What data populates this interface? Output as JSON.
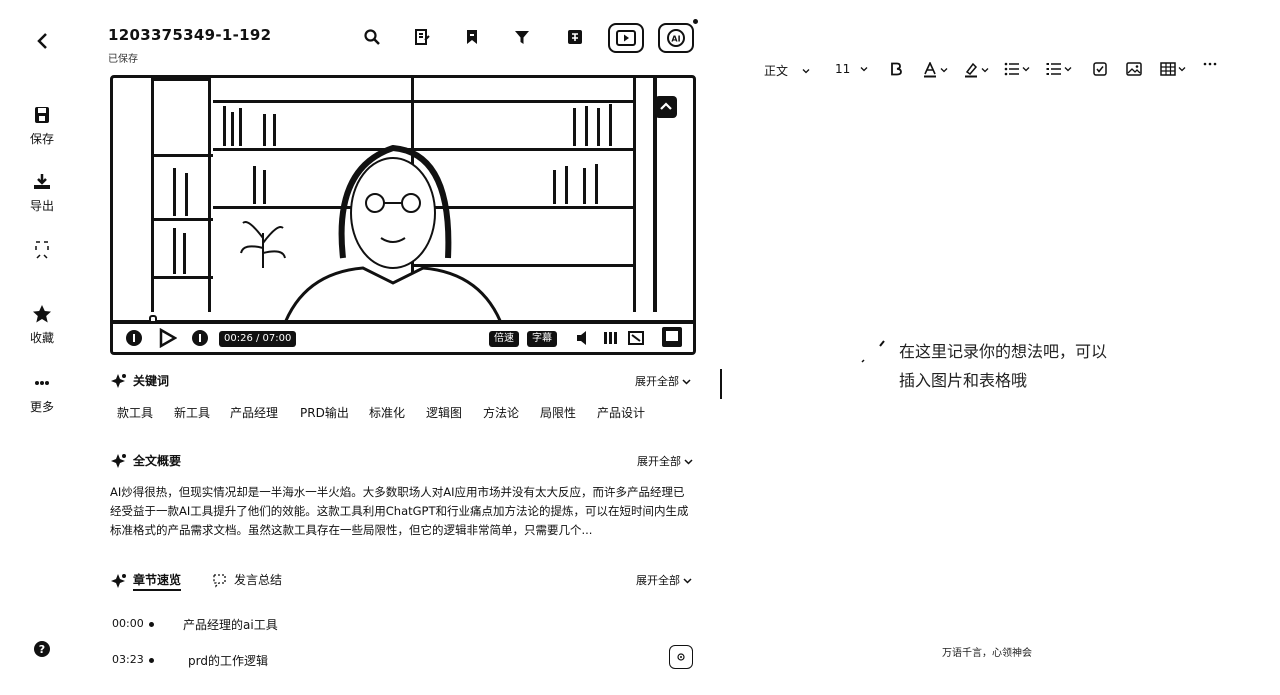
{
  "header": {
    "title": "1203375349-1-192",
    "saved_status": "已保存"
  },
  "rail": {
    "save": "保存",
    "export": "导出",
    "collect": "收藏",
    "more": "更多"
  },
  "video": {
    "time": "00:26 / 07:00",
    "speed": "倍速",
    "subtitle": "字幕",
    "progress": 0.062
  },
  "keywords": {
    "heading": "关键词",
    "expand": "展开全部",
    "items": [
      "款工具",
      "新工具",
      "产品经理",
      "PRD输出",
      "标准化",
      "逻辑图",
      "方法论",
      "局限性",
      "产品设计"
    ]
  },
  "summary": {
    "heading": "全文概要",
    "expand": "展开全部",
    "text": "AI炒得很热，但现实情况却是一半海水一半火焰。大多数职场人对AI应用市场并没有太大反应，而许多产品经理已经受益于一款AI工具提升了他们的效能。这款工具利用ChatGPT和行业痛点加方法论的提炼，可以在短时间内生成标准格式的产品需求文档。虽然这款工具存在一些局限性，但它的逻辑非常简单，只需要几个..."
  },
  "chapters": {
    "tab_active": "章节速览",
    "tab_other": "发言总结",
    "expand": "展开全部",
    "items": [
      {
        "time": "00:00",
        "title": "产品经理的ai工具"
      },
      {
        "time": "03:23",
        "title": "prd的工作逻辑"
      }
    ]
  },
  "editor": {
    "style": "正文",
    "font_size": "11",
    "placeholder_line1": "在这里记录你的想法吧，可以",
    "placeholder_line2": "插入图片和表格哦",
    "footer": "万语千言，心领神会"
  }
}
